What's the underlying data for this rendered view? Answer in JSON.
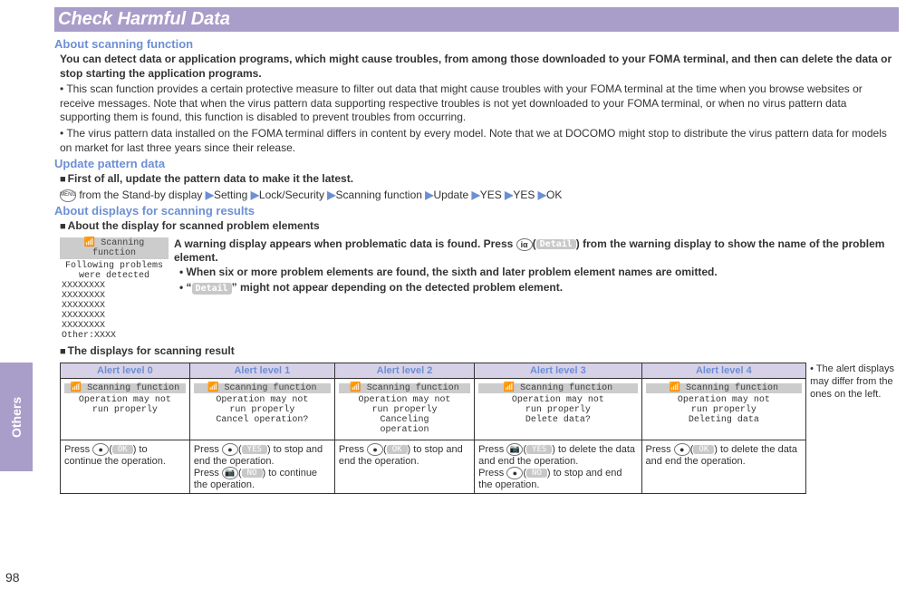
{
  "side_tab": "Others",
  "page_number": "98",
  "title": "Check Harmful Data",
  "section1": {
    "head": "About scanning function",
    "lead": "You can detect data or application programs, which might cause troubles, from among those downloaded to your FOMA terminal, and then can delete the data or stop starting the application programs.",
    "b1": "This scan function provides a certain protective measure to filter out data that might cause troubles with your FOMA terminal at the time when you browse websites or receive messages. Note that when the virus pattern data supporting respective troubles is not yet downloaded to your FOMA terminal, or when no virus pattern data supporting them is found, this function is disabled to prevent troubles from occurring.",
    "b2": "The virus pattern data installed on the FOMA terminal differs in content by every model. Note that we at DOCOMO might stop to distribute the virus pattern data for models on market for last three years since their release."
  },
  "section2": {
    "head": "Update pattern data",
    "sub": "First of all, update the pattern data to make it the latest.",
    "menu_icon": "MENU",
    "nav_pre": " from the Stand-by display",
    "nav1": "Setting",
    "nav2": "Lock/Security",
    "nav3": "Scanning function",
    "nav4": "Update",
    "nav5": "YES",
    "nav6": "YES",
    "nav7": "OK"
  },
  "section3": {
    "head": "About displays for scanning results",
    "sub1": "About the display for scanned problem elements",
    "screen": {
      "title": "Scanning function",
      "l1": "Following problems",
      "l2": "were detected",
      "x1": "XXXXXXXX",
      "x2": "XXXXXXXX",
      "x3": "XXXXXXXX",
      "x4": "XXXXXXXX",
      "x5": "XXXXXXXX",
      "other": "Other:XXXX"
    },
    "warn_lead": "A warning display appears when problematic data is found. Press ",
    "softkey": "iα",
    "detail": "Detail",
    "warn_tail": ") from the warning display to show the name of the problem element.",
    "wb1": "When six or more problem elements are found, the sixth and later problem element names are omitted.",
    "wb2a": "“",
    "wb2b": "” might not appear depending on the detected problem element.",
    "sub2": "The displays for scanning result"
  },
  "alerts": {
    "h0": "Alert level 0",
    "h1": "Alert level 1",
    "h2": "Alert level 2",
    "h3": "Alert level 3",
    "h4": "Alert level 4",
    "stitle": "Scanning function",
    "s0a": "Operation may not",
    "s0b": "run properly",
    "s1a": "Operation may not",
    "s1b": "run properly",
    "s1c": "Cancel operation?",
    "s2a": "Operation may not",
    "s2b": "run properly",
    "s2c": "Canceling",
    "s2d": "operation",
    "s3a": "Operation may not",
    "s3b": "run properly",
    "s3c": "Delete data?",
    "s4a": "Operation may not",
    "s4b": "run properly",
    "s4c": "Deleting data",
    "ok": "OK",
    "yes": "YES",
    "no": "NO",
    "d0": "Press ",
    "d0b": ") to continue the operation.",
    "d1a": "Press ",
    "d1b": ") to stop and end the operation.",
    "d1c": "Press ",
    "d1d": ") to continue the operation.",
    "d2a": "Press ",
    "d2b": ") to stop and end the operation.",
    "d3a": "Press ",
    "d3b": ") to delete the data and end the operation.",
    "d3c": "Press ",
    "d3d": ") to stop and end the operation.",
    "d4a": "Press ",
    "d4b": ") to delete the data and end the operation."
  },
  "side_note": "The alert displays may differ from the ones on the left."
}
